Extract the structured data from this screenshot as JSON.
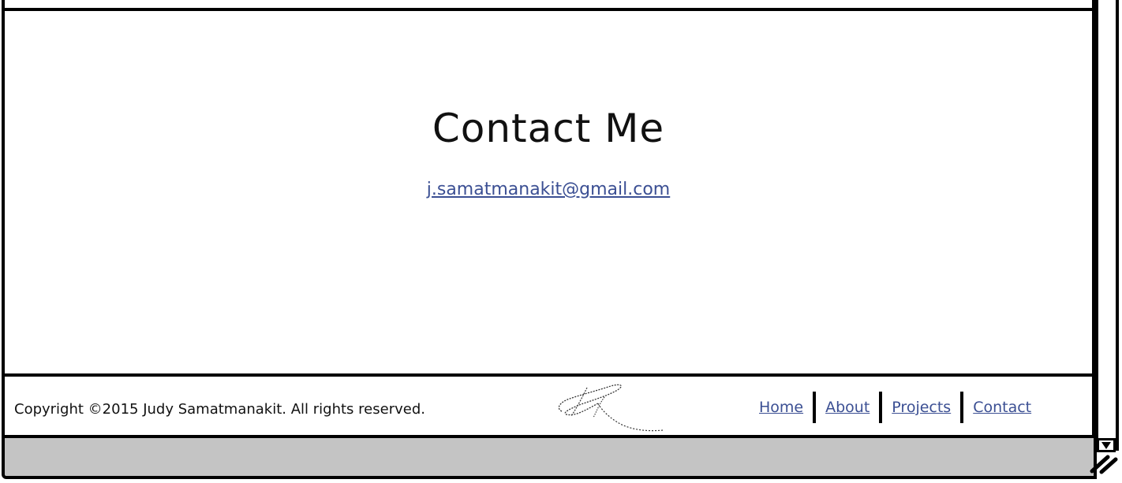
{
  "contact": {
    "heading": "Contact Me",
    "email": "j.samatmanakit@gmail.com"
  },
  "footer": {
    "copyright": "Copyright ©2015 Judy Samatmanakit. All rights reserved.",
    "nav": [
      {
        "label": "Home"
      },
      {
        "label": "About"
      },
      {
        "label": "Projects"
      },
      {
        "label": "Contact"
      }
    ]
  },
  "colors": {
    "link": "#3b4f93",
    "statusbar": "#c4c4c4",
    "frame": "#000000"
  },
  "icons": {
    "signature": "signature-logo",
    "scroll_down": "triangle-down-icon",
    "resize_grip": "resize-grip-icon"
  }
}
